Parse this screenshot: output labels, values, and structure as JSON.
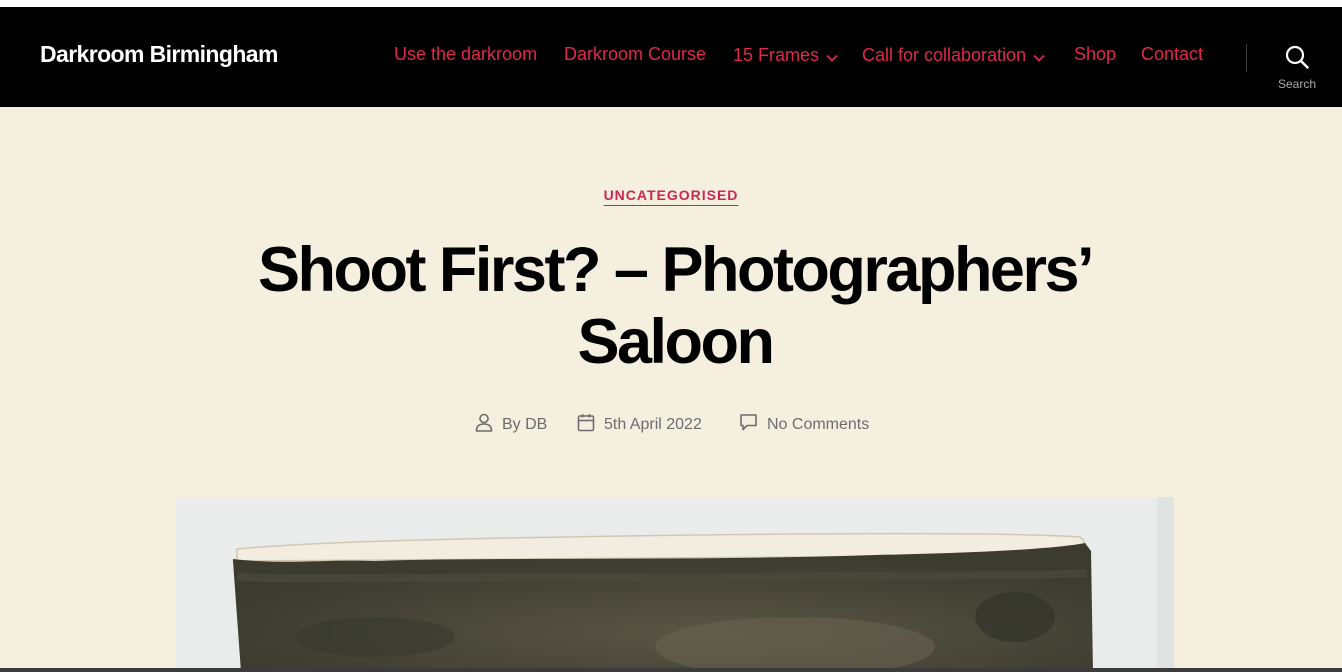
{
  "header": {
    "site_title": "Darkroom Birmingham",
    "nav": [
      {
        "label": "Use the darkroom",
        "has_submenu": false
      },
      {
        "label": "Darkroom Course",
        "has_submenu": false
      },
      {
        "label": "15 Frames",
        "has_submenu": true
      },
      {
        "label": "Call for collaboration",
        "has_submenu": true
      },
      {
        "label": "Shop",
        "has_submenu": false
      },
      {
        "label": "Contact",
        "has_submenu": false
      }
    ],
    "search_label": "Search",
    "search_icon": "search-icon"
  },
  "post": {
    "category": "UNCATEGORISED",
    "title": "Shoot First? – Photographers’ Saloon",
    "author": "By DB",
    "date": "5th April 2022",
    "comments": "No Comments"
  },
  "colors": {
    "accent": "#cd2653",
    "nav_link": "#e0284a",
    "header_bg": "#000000",
    "page_bg": "#f5efdf",
    "meta_text": "#6d6d6d"
  }
}
